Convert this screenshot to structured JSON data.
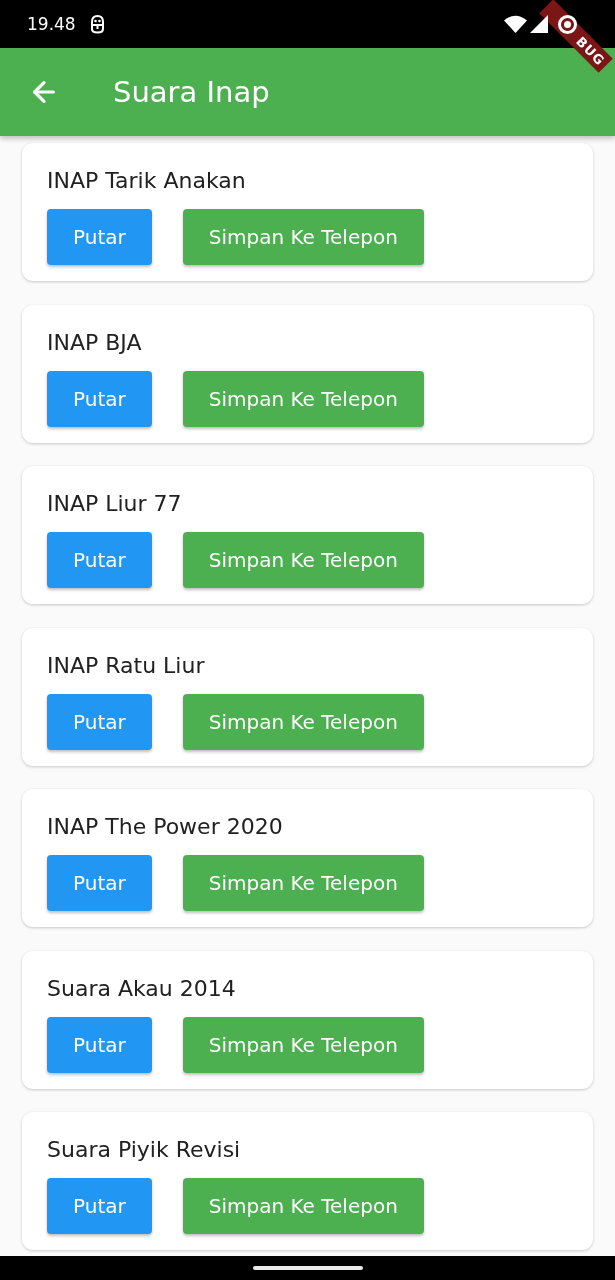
{
  "status_bar": {
    "time": "19.48"
  },
  "app_bar": {
    "title": "Suara Inap"
  },
  "debug_banner": {
    "label": "BUG"
  },
  "sounds": [
    {
      "title": "INAP Tarik Anakan",
      "buttons": [
        {
          "kind": "play",
          "label": "Putar"
        },
        {
          "kind": "save",
          "label": "Simpan Ke Telepon"
        }
      ]
    },
    {
      "title": "INAP BJA",
      "buttons": [
        {
          "kind": "play",
          "label": "Putar"
        },
        {
          "kind": "save",
          "label": "Simpan Ke Telepon"
        }
      ]
    },
    {
      "title": "INAP Liur 77",
      "buttons": [
        {
          "kind": "play",
          "label": "Putar"
        },
        {
          "kind": "save",
          "label": "Simpan Ke Telepon"
        }
      ]
    },
    {
      "title": "INAP Ratu Liur",
      "buttons": [
        {
          "kind": "play",
          "label": "Putar"
        },
        {
          "kind": "save",
          "label": "Simpan Ke Telepon"
        }
      ]
    },
    {
      "title": "INAP The Power 2020",
      "buttons": [
        {
          "kind": "play",
          "label": "Putar"
        },
        {
          "kind": "save",
          "label": "Simpan Ke Telepon"
        }
      ]
    },
    {
      "title": "Suara Akau 2014",
      "buttons": [
        {
          "kind": "play",
          "label": "Putar"
        },
        {
          "kind": "save",
          "label": "Simpan Ke Telepon"
        }
      ]
    },
    {
      "title": "Suara Piyik Revisi",
      "buttons": [
        {
          "kind": "play",
          "label": "Putar"
        },
        {
          "kind": "save",
          "label": "Simpan Ke Telepon"
        }
      ]
    }
  ]
}
